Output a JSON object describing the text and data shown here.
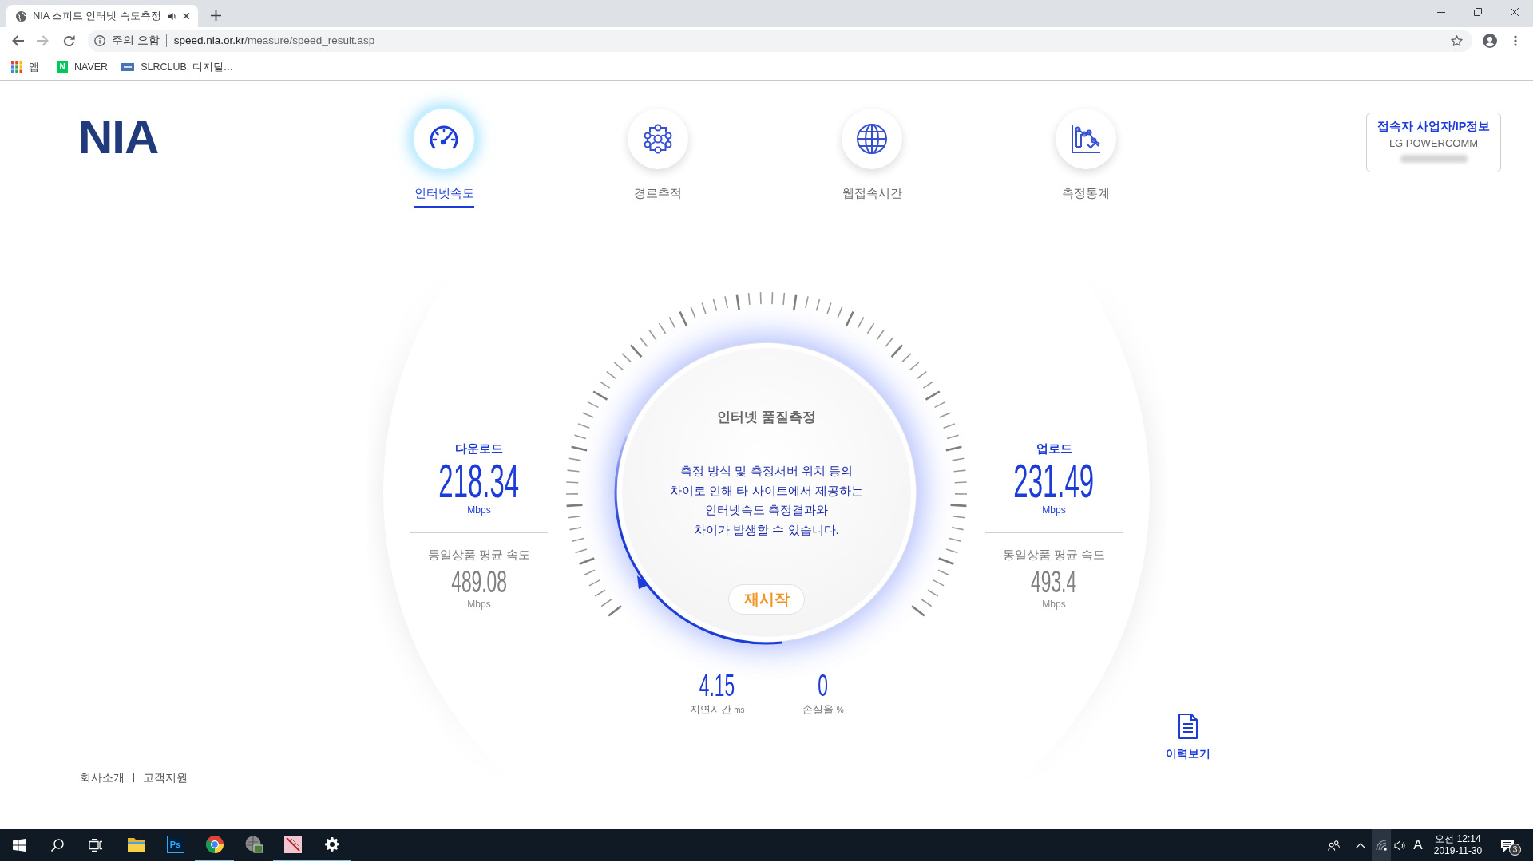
{
  "browser": {
    "tab": {
      "title": "NIA 스피드 인터넷 속도측정",
      "audio": true
    },
    "address": {
      "security": "주의 요함",
      "host": "speed.nia.or.kr",
      "path": "/measure/speed_result.asp"
    },
    "bookmarks": [
      {
        "kind": "apps",
        "label": "앱"
      },
      {
        "kind": "naver",
        "badge": "N",
        "label": "NAVER"
      },
      {
        "kind": "slr",
        "label": "SLRCLUB, 디지털…"
      }
    ]
  },
  "site": {
    "logo": "NIA",
    "nav": [
      {
        "kind": "speed",
        "label": "인터넷속도",
        "selected": true
      },
      {
        "kind": "route",
        "label": "경로추적",
        "selected": false
      },
      {
        "kind": "web",
        "label": "웹접속시간",
        "selected": false
      },
      {
        "kind": "stats",
        "label": "측정통계",
        "selected": false
      }
    ],
    "isp": {
      "title": "접속자 사업자/IP정보",
      "provider": "LG POWERCOMM"
    },
    "gauge": {
      "title": "인터넷 품질측정",
      "notice": "측정 방식 및 측정서버 위치 등의\n차이로 인해 타 사이트에서 제공하는\n인터넷속도 측정결과와\n차이가 발생할 수 있습니다.",
      "restart": "재시작"
    },
    "results": [
      {
        "label": "다운로드",
        "value": "218.34",
        "unit": "Mbps",
        "avg_label": "동일상품 평균 속도",
        "avg_value": "489.08",
        "avg_unit": "Mbps"
      },
      {
        "label": "업로드",
        "value": "231.49",
        "unit": "Mbps",
        "avg_label": "동일상품 평균 속도",
        "avg_value": "493.4",
        "avg_unit": "Mbps"
      }
    ],
    "stats": [
      {
        "value": "4.15",
        "label": "지연시간",
        "unit": "ms"
      },
      {
        "value": "0",
        "label": "손실율",
        "unit": "%"
      }
    ],
    "history": "이력보기",
    "footer": [
      "회사소개",
      "고객지원"
    ]
  },
  "taskbar": {
    "apps": [
      {
        "kind": "explorer",
        "running": false
      },
      {
        "kind": "photoshop",
        "label": "Ps",
        "running": false
      },
      {
        "kind": "chrome",
        "running": true
      },
      {
        "kind": "viewer",
        "running": false
      },
      {
        "kind": "paint",
        "running": true
      },
      {
        "kind": "settings",
        "running": true
      }
    ],
    "tray": {
      "ime": "A",
      "time": "오전 12:14",
      "date": "2019-11-30",
      "notifications": "3"
    }
  }
}
